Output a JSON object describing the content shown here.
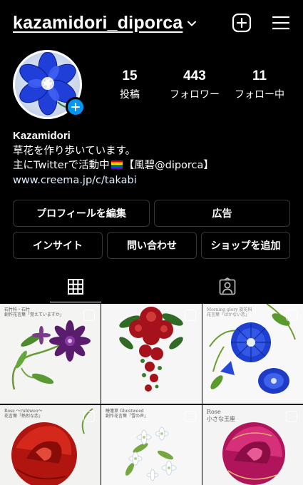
{
  "header": {
    "username": "kazamidori_diporca"
  },
  "stats": [
    {
      "count": "15",
      "label": "投稿"
    },
    {
      "count": "443",
      "label": "フォロワー"
    },
    {
      "count": "11",
      "label": "フォロー中"
    }
  ],
  "bio": {
    "name": "Kazamidori",
    "line1": "草花を作り歩いています。",
    "line2_pre": "主にTwitterで活動中",
    "line2_post": "【風碧@diporca】",
    "link": "www.creema.jp/c/takabi"
  },
  "buttons": {
    "edit_profile": "プロフィールを編集",
    "ads": "広告",
    "insights": "インサイト",
    "contact": "問い合わせ",
    "add_shop": "ショップを追加"
  },
  "posts": [
    {
      "caption1": "石竹科・石竹",
      "caption2": "創作花言葉「覚えていますか」"
    },
    {
      "caption1": "",
      "caption2": ""
    },
    {
      "caption1": "Morning glory 旋花科",
      "caption2": "花言葉「はかない恋」"
    },
    {
      "caption1": "Rose ～rubiweo～",
      "caption2": "花言葉「熱烈な恋」"
    },
    {
      "caption1": "睡蓮草 Ghostweed",
      "caption2": "創作花言葉「雪の声」"
    },
    {
      "caption1": "Rose",
      "caption2": "小さな王座"
    }
  ],
  "colors": {
    "accent_blue": "#0095f6",
    "border": "#363636",
    "background": "#000000"
  }
}
